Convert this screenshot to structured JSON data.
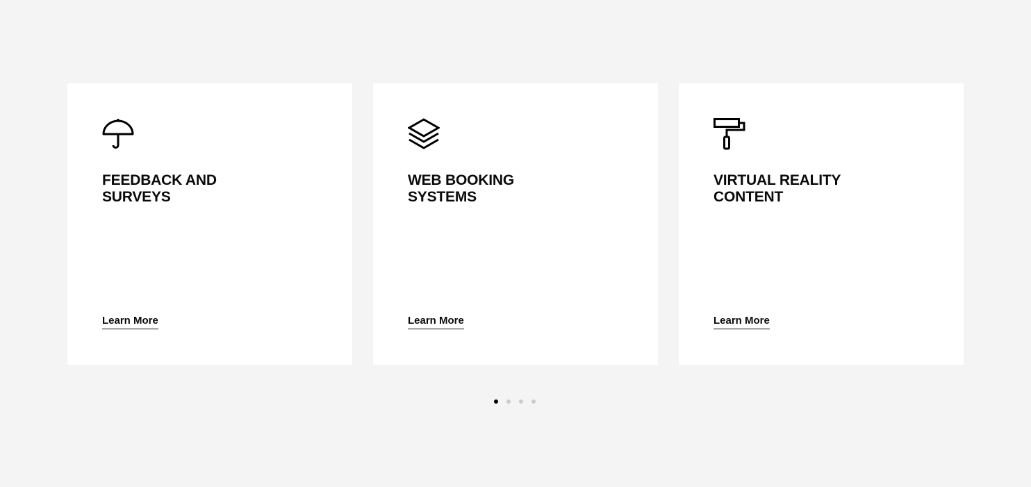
{
  "cards": [
    {
      "icon": "umbrella-icon",
      "title_line1": "FEEDBACK AND",
      "title_line2": "SURVEYS",
      "link": "Learn More"
    },
    {
      "icon": "layers-icon",
      "title_line1": "WEB BOOKING",
      "title_line2": "SYSTEMS",
      "link": "Learn More"
    },
    {
      "icon": "paint-roller-icon",
      "title_line1": "VIRTUAL REALITY",
      "title_line2": "CONTENT",
      "link": "Learn More"
    }
  ],
  "pagination": {
    "count": 4,
    "active_index": 0
  },
  "colors": {
    "background": "#f4f4f4",
    "card": "#ffffff",
    "text": "#0a0a0a",
    "dot_active": "#000000",
    "dot_inactive": "#cccccc"
  }
}
